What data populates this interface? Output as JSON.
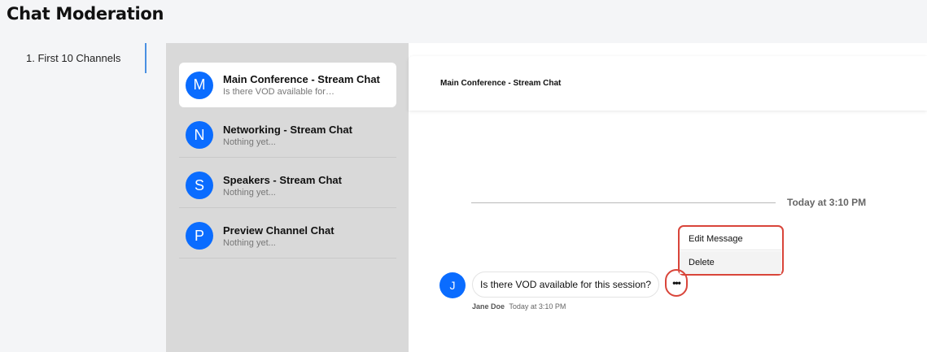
{
  "page": {
    "title": "Chat Moderation"
  },
  "nav": {
    "items": [
      {
        "label": "1. First 10 Channels"
      }
    ]
  },
  "channels": [
    {
      "initial": "M",
      "name": "Main Conference - Stream Chat",
      "preview": "Is there VOD available for…"
    },
    {
      "initial": "N",
      "name": "Networking - Stream Chat",
      "preview": "Nothing yet..."
    },
    {
      "initial": "S",
      "name": "Speakers - Stream Chat",
      "preview": "Nothing yet..."
    },
    {
      "initial": "P",
      "name": "Preview Channel Chat",
      "preview": "Nothing yet..."
    }
  ],
  "chat": {
    "header_title": "Main Conference - Stream Chat",
    "date_separator": "Today at 3:10 PM",
    "message": {
      "initial": "J",
      "text": "Is there VOD available for this session?",
      "author": "Jane Doe",
      "time": "Today at 3:10 PM",
      "options_label": "•••"
    },
    "menu": {
      "edit_label": "Edit Message",
      "delete_label": "Delete"
    }
  },
  "colors": {
    "accent": "#0a6cff",
    "highlight": "#d9453a",
    "nav_active": "#4a90e2"
  }
}
